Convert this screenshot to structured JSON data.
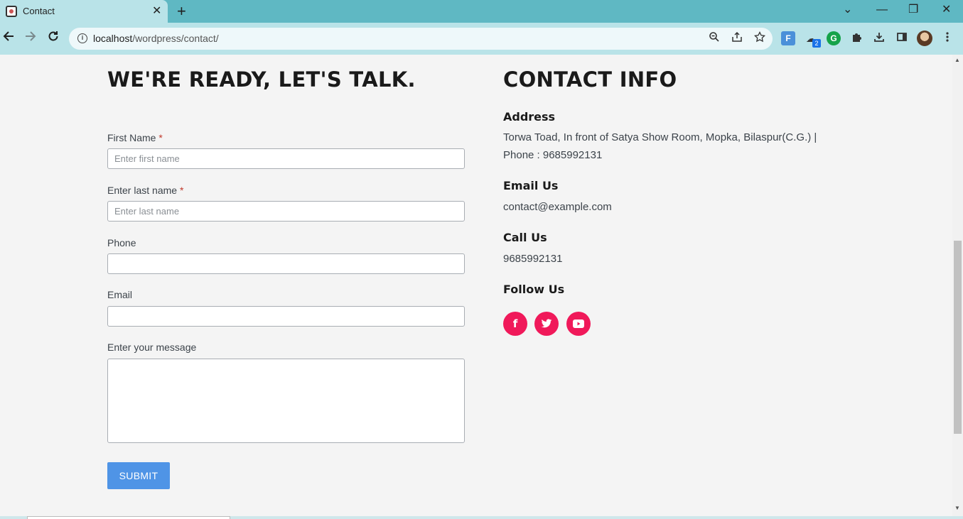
{
  "browser": {
    "tab_title": "Contact",
    "tab_close": "✕",
    "new_tab": "+",
    "url_host": "localhost",
    "url_path": "/wordpress/contact/",
    "extension_badge": "2",
    "window_controls": [
      "⌄",
      "—",
      "❐",
      "✕"
    ]
  },
  "form": {
    "heading": "WE'RE READY, LET'S TALK.",
    "first_name_label": "First Name",
    "first_name_placeholder": "Enter first name",
    "last_name_label": "Enter last name",
    "last_name_placeholder": "Enter last name",
    "required_mark": "*",
    "phone_label": "Phone",
    "email_label": "Email",
    "message_label": "Enter your message",
    "submit_label": "SUBMIT"
  },
  "contact": {
    "heading": "CONTACT INFO",
    "address_title": "Address",
    "address_line1": "Torwa Toad, In front of Satya Show Room, Mopka, Bilaspur(C.G.) |",
    "address_line2": "Phone : 9685992131",
    "email_title": "Email Us",
    "email_value": "contact@example.com",
    "call_title": "Call Us",
    "call_value": "9685992131",
    "follow_title": "Follow Us"
  },
  "social": [
    {
      "icon": "facebook-icon",
      "glyph": "f"
    },
    {
      "icon": "twitter-icon",
      "glyph": "🐦"
    },
    {
      "icon": "youtube-icon",
      "glyph": "▶"
    }
  ],
  "colors": {
    "social_accent": "#f0195a",
    "submit_button": "#4f94e6",
    "browser_frame": "#5fb8c3"
  }
}
